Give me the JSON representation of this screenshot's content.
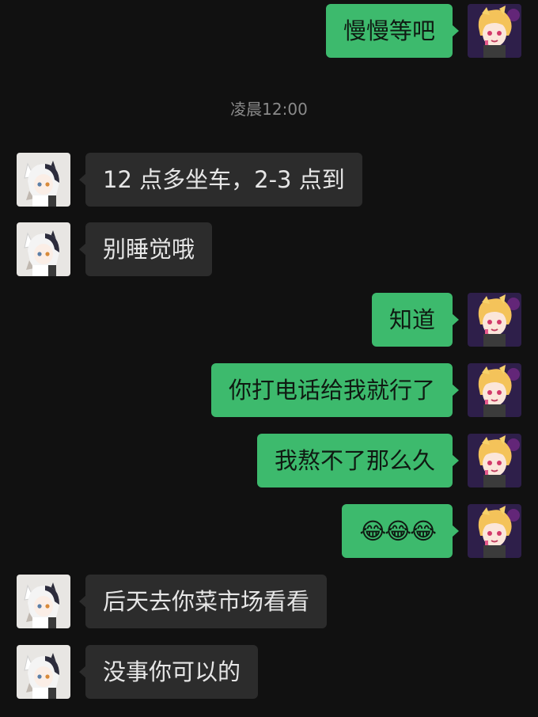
{
  "timestamp": "凌晨12:00",
  "messages": [
    {
      "side": "right",
      "text": "慢慢等吧"
    },
    {
      "side": "left",
      "text": "12 点多坐车，2-3 点到"
    },
    {
      "side": "left",
      "text": "别睡觉哦"
    },
    {
      "side": "right",
      "text": "知道"
    },
    {
      "side": "right",
      "text": "你打电话给我就行了"
    },
    {
      "side": "right",
      "text": "我熬不了那么久"
    },
    {
      "side": "right",
      "text": "😂😂😂"
    },
    {
      "side": "left",
      "text": "后天去你菜市场看看"
    },
    {
      "side": "left",
      "text": "没事你可以的"
    }
  ],
  "colors": {
    "background": "#111111",
    "outgoing_bubble": "#3dba6d",
    "incoming_bubble": "#2c2c2c",
    "timestamp_text": "#8a8a8a"
  },
  "avatars": {
    "self": "blonde-anime-avatar-icon",
    "contact": "catgirl-anime-avatar-icon"
  }
}
